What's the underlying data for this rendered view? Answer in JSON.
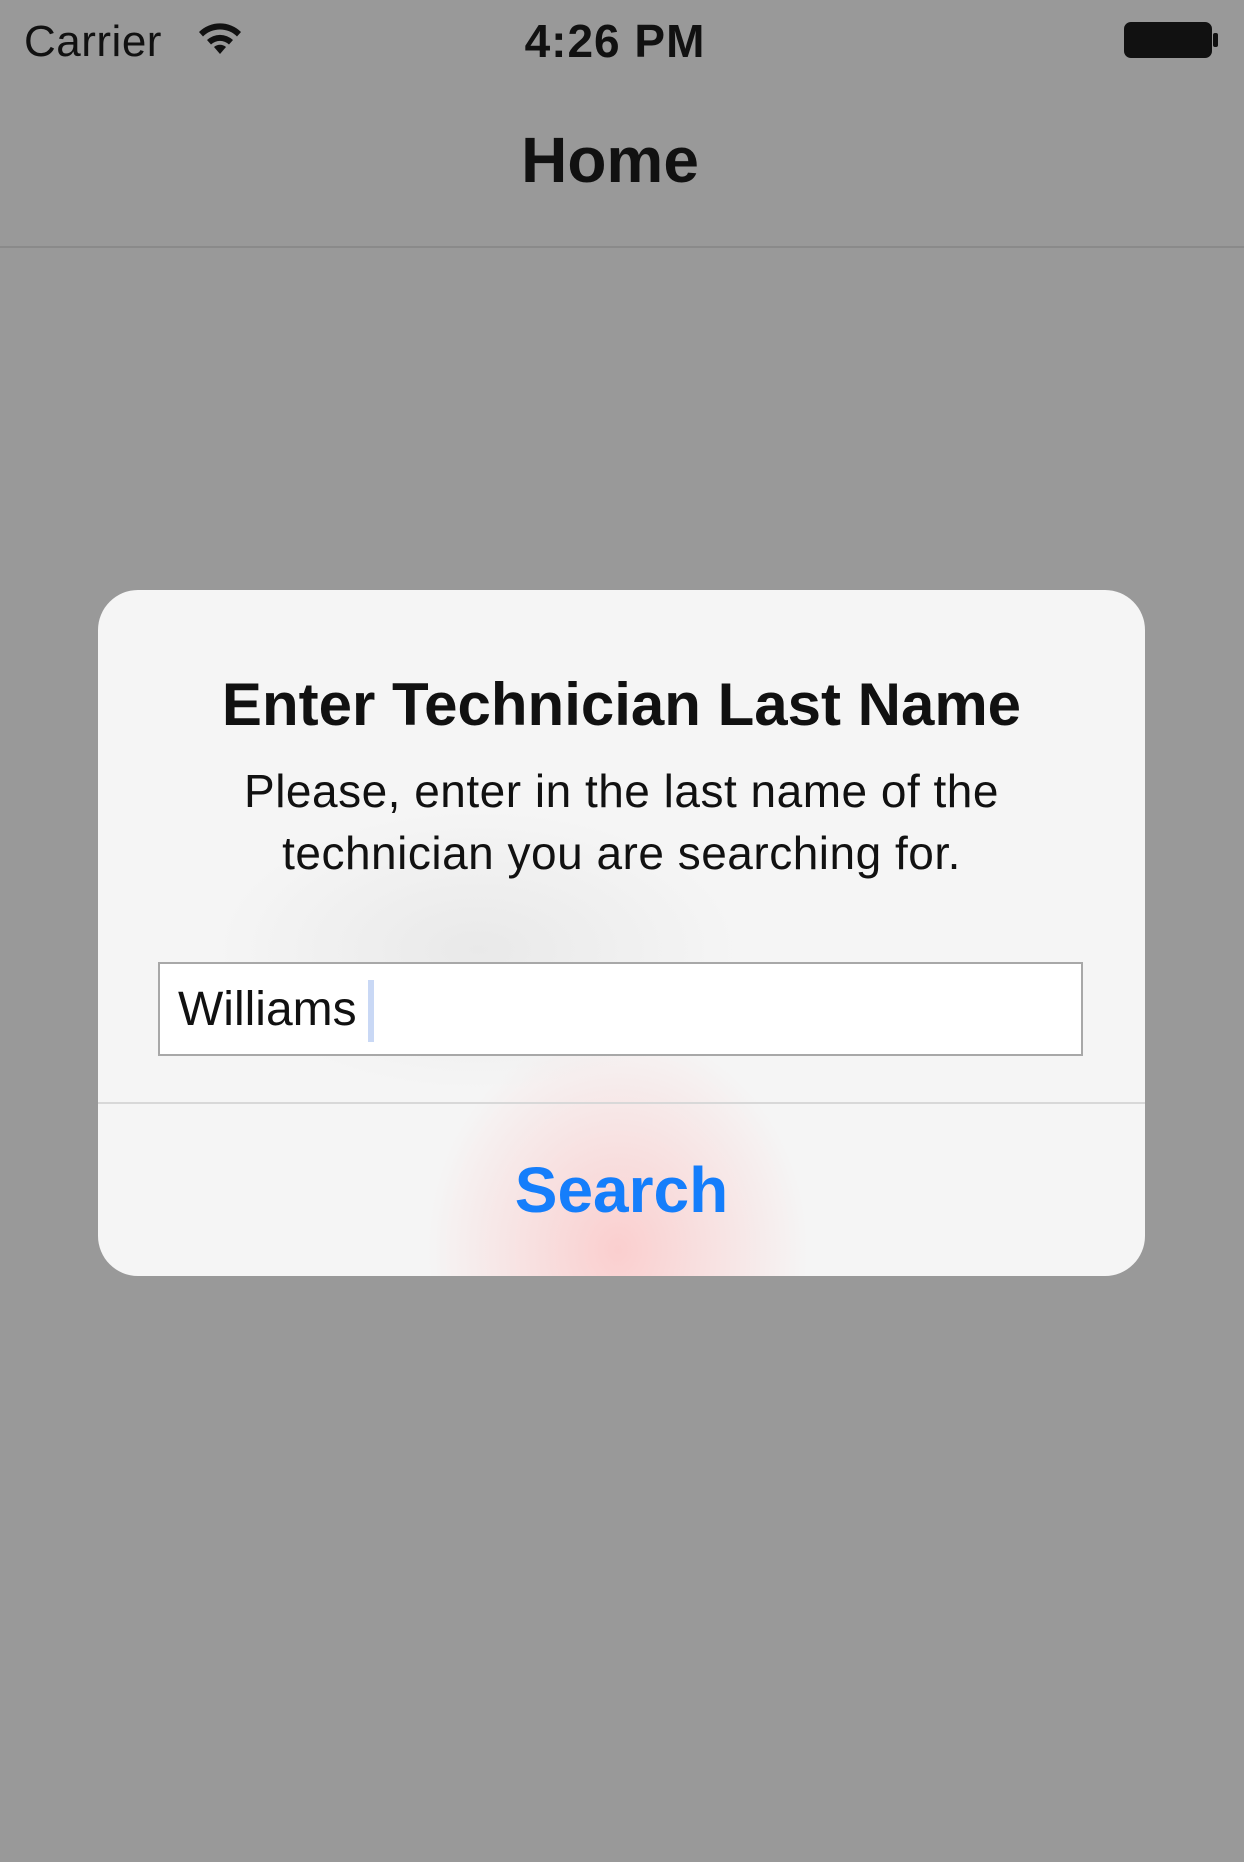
{
  "status_bar": {
    "carrier": "Carrier",
    "time": "4:26 PM",
    "wifi_icon": "wifi-icon",
    "battery_icon": "battery-icon"
  },
  "nav_bar": {
    "title": "Home"
  },
  "alert": {
    "title": "Enter Technician Last Name",
    "message": "Please, enter in the last name of the technician you are searching for.",
    "input_value": "Williams",
    "search_label": "Search"
  },
  "colors": {
    "background": "#999999",
    "alert_background": "#f5f5f5",
    "accent": "#157efb",
    "text": "#111111"
  }
}
